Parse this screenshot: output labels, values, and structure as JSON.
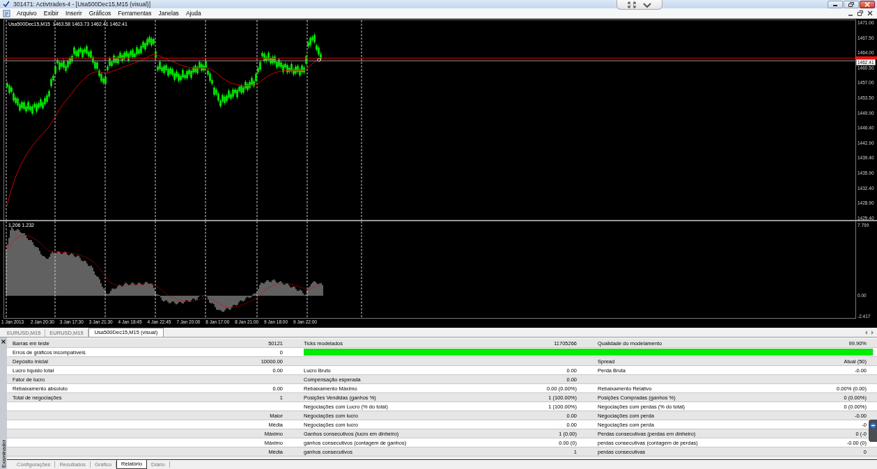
{
  "window": {
    "title": "301471: Activtrades-4 - [Usa500Dec15,M15 (visual)]"
  },
  "menu": [
    "Arquivo",
    "Exibir",
    "Inserir",
    "Gráficos",
    "Ferramentas",
    "Janelas",
    "Ajuda"
  ],
  "chart": {
    "header": "Usa500Dec15,M15  1463.58 1463.73 1462.41 1462.41",
    "indicator_label": "1.206 1.232",
    "price_tag": "1462.41",
    "price_axis": [
      "1471.00",
      "1467.50",
      "1464.00",
      "1460.50",
      "1457.00",
      "1453.50",
      "1449.90",
      "1446.40",
      "1442.90",
      "1439.40",
      "1435.90",
      "1432.40",
      "1428.90",
      "1425.40"
    ],
    "indicator_axis": [
      "7.799",
      "0.00",
      "-2.417"
    ],
    "time_axis": [
      "1 Jan 2013",
      "2 Jan 20:30",
      "3 Jan 17:30",
      "3 Jan 21:30",
      "4 Jan 18:45",
      "4 Jan 22:45",
      "7 Jan 20:00",
      "8 Jan 17:00",
      "8 Jan 21:00",
      "9 Jan 18:00",
      "9 Jan 22:00"
    ]
  },
  "chart_tabs": [
    {
      "label": "EURUSD,M15",
      "selected": false
    },
    {
      "label": "EURUSD,M15",
      "selected": false
    },
    {
      "label": "Usa500Dec15,M15 (visual)",
      "selected": true
    }
  ],
  "report": {
    "rows": [
      {
        "kind": "stats",
        "cells": [
          {
            "label": "Barras em teste",
            "value": "50121"
          },
          {
            "label": "Ticks modelados",
            "value": "11705266"
          },
          {
            "label": "Qualidade do modelamento",
            "value": "99.90%"
          }
        ]
      },
      {
        "kind": "quality_bar",
        "cells": [
          {
            "label": "Erros de gráficos incompatíveis",
            "value": "0"
          }
        ],
        "level": 0.999
      },
      {
        "kind": "stats",
        "cells": [
          {
            "label": "Depósito Inicial",
            "value": "10000.00"
          },
          null,
          {
            "label": "Spread",
            "value": "Atual (50)"
          }
        ]
      },
      {
        "kind": "stats",
        "cells": [
          {
            "label": "Lucro líquido total",
            "value": "0.00"
          },
          {
            "label": "Lucro Bruto",
            "value": "0.00"
          },
          {
            "label": "Perda Bruta",
            "value": "-0.00"
          }
        ]
      },
      {
        "kind": "stats",
        "cells": [
          {
            "label": "Fator de lucro"
          },
          {
            "label": "Compensação esperada",
            "value": "0.00"
          },
          null
        ]
      },
      {
        "kind": "stats",
        "cells": [
          {
            "label": "Rebaixamento absoluto",
            "value": "0.00"
          },
          {
            "label": "Rebaixamento Máximo",
            "value": "0.00 (0.00%)"
          },
          {
            "label": "Rebaixamento Relativo",
            "value": "0.00% (0.00)"
          }
        ]
      },
      {
        "kind": "stats",
        "cells": [
          {
            "label": "Total de negociações",
            "value": "1"
          },
          {
            "label": "Posições Vendidas (ganhos %)",
            "value": "1 (100.00%)"
          },
          {
            "label": "Posições Compradas (ganhos %)",
            "value": "0 (0.00%)"
          }
        ]
      },
      {
        "kind": "stats",
        "cells": [
          null,
          {
            "label": "Negociações com Lucro (% do total)",
            "value": "1 (100.00%)"
          },
          {
            "label": "Negociações com perdas (% do total)",
            "value": "0 (0.00%)"
          }
        ]
      },
      {
        "kind": "stats",
        "cells": [
          {
            "value": "Maior"
          },
          {
            "label": "Negociações com lucro",
            "value": "0.00"
          },
          {
            "label": "Negociações com perda",
            "value": "-0.00"
          }
        ]
      },
      {
        "kind": "stats",
        "cells": [
          {
            "value": "Média"
          },
          {
            "label": "Negociações com lucro",
            "value": "0.00"
          },
          {
            "label": "Negociações com perda",
            "value": "-0"
          }
        ]
      },
      {
        "kind": "stats",
        "cells": [
          {
            "value": "Máximo"
          },
          {
            "label": "Ganhos consecutivos (lucro em dinheiro)",
            "value": "1 (0.00)"
          },
          {
            "label": "Perdas consecutivas (perdas em dinheiro)",
            "value": "0 (-0"
          }
        ]
      },
      {
        "kind": "stats",
        "cells": [
          {
            "value": "Máximo"
          },
          {
            "label": "ganhos consecutivos (contagem de ganhos)",
            "value": "0.00 (0)"
          },
          {
            "label": "perdas consecutivas (contagem de perdas)",
            "value": "-0.00 (0)"
          }
        ]
      },
      {
        "kind": "stats",
        "cells": [
          {
            "value": "Média"
          },
          {
            "label": "ganhos consecutivos",
            "value": "1"
          },
          {
            "label": "perdas consecutivas",
            "value": "0"
          }
        ]
      }
    ]
  },
  "panel_title": "Examinador",
  "bottom_tabs": [
    {
      "label": "Configurações",
      "selected": false
    },
    {
      "label": "Resultados",
      "selected": false
    },
    {
      "label": "Gráfico",
      "selected": false
    },
    {
      "label": "Relatório",
      "selected": true
    },
    {
      "label": "Diário",
      "selected": false
    }
  ]
}
